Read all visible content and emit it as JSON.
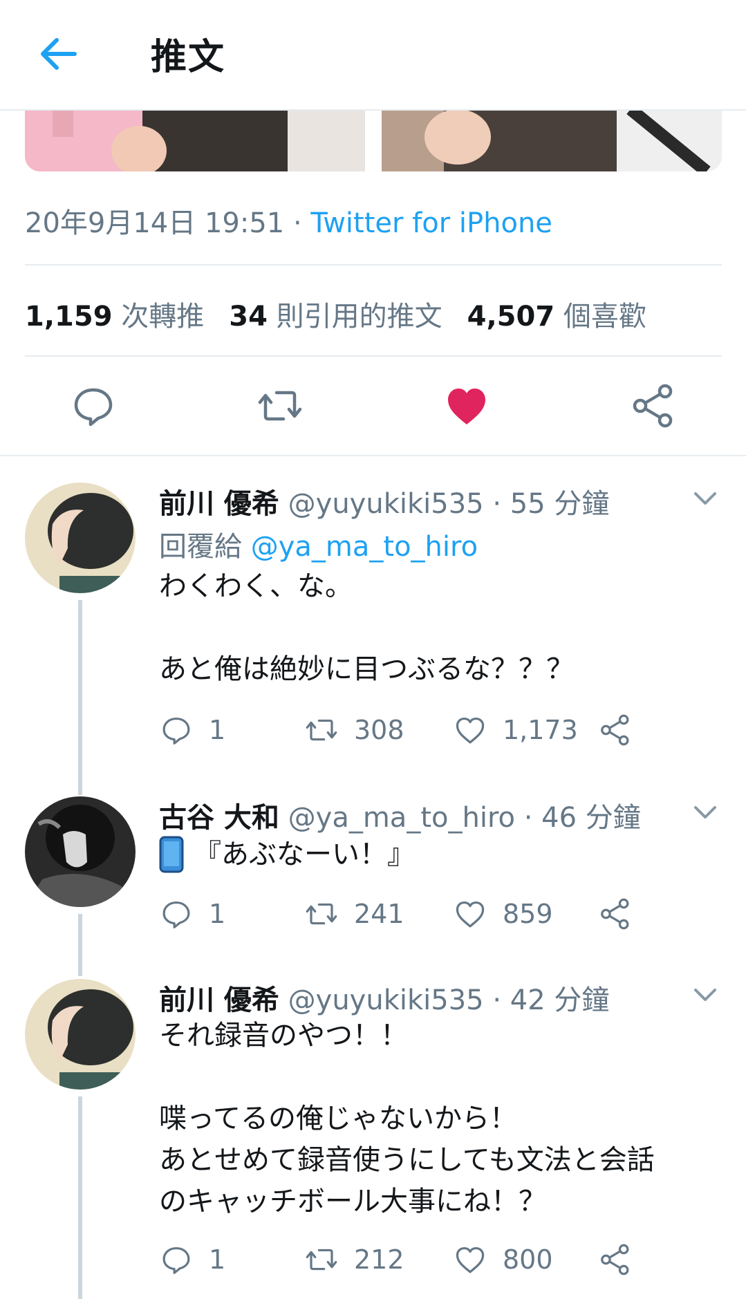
{
  "header": {
    "title": "推文"
  },
  "tweet": {
    "timestamp": "20年9月14日 19:51",
    "dot": " · ",
    "source": "Twitter for iPhone",
    "stats": {
      "retweets_num": "1,159",
      "retweets_label": "次轉推",
      "quotes_num": "34",
      "quotes_label": "則引用的推文",
      "likes_num": "4,507",
      "likes_label": "個喜歡"
    },
    "liked": true
  },
  "colors": {
    "accent": "#1da1f2",
    "like": "#e0245e",
    "muted": "#657786",
    "text": "#14171a"
  },
  "replies": [
    {
      "name": "前川 優希",
      "handle": "@yuyukiki535",
      "time": "· 55 分鐘",
      "reply_to_label": "回覆給",
      "reply_to_handle": "@ya_ma_to_hiro",
      "lines": [
        "わくわく、な。",
        "",
        "あと俺は絶妙に目つぶるな？？？"
      ],
      "reply_count": "1",
      "retweet_count": "308",
      "like_count": "1,173"
    },
    {
      "name": "古谷 大和",
      "handle": "@ya_ma_to_hiro",
      "time": "· 46 分鐘",
      "lines": [
        "『あぶなーい！』"
      ],
      "reply_count": "1",
      "retweet_count": "241",
      "like_count": "859"
    },
    {
      "name": "前川 優希",
      "handle": "@yuyukiki535",
      "time": "· 42 分鐘",
      "lines": [
        "それ録音のやつ！！",
        "",
        "喋ってるの俺じゃないから！",
        "あとせめて録音使うにしても文法と会話",
        "のキャッチボール大事にね！？"
      ],
      "reply_count": "1",
      "retweet_count": "212",
      "like_count": "800"
    }
  ]
}
